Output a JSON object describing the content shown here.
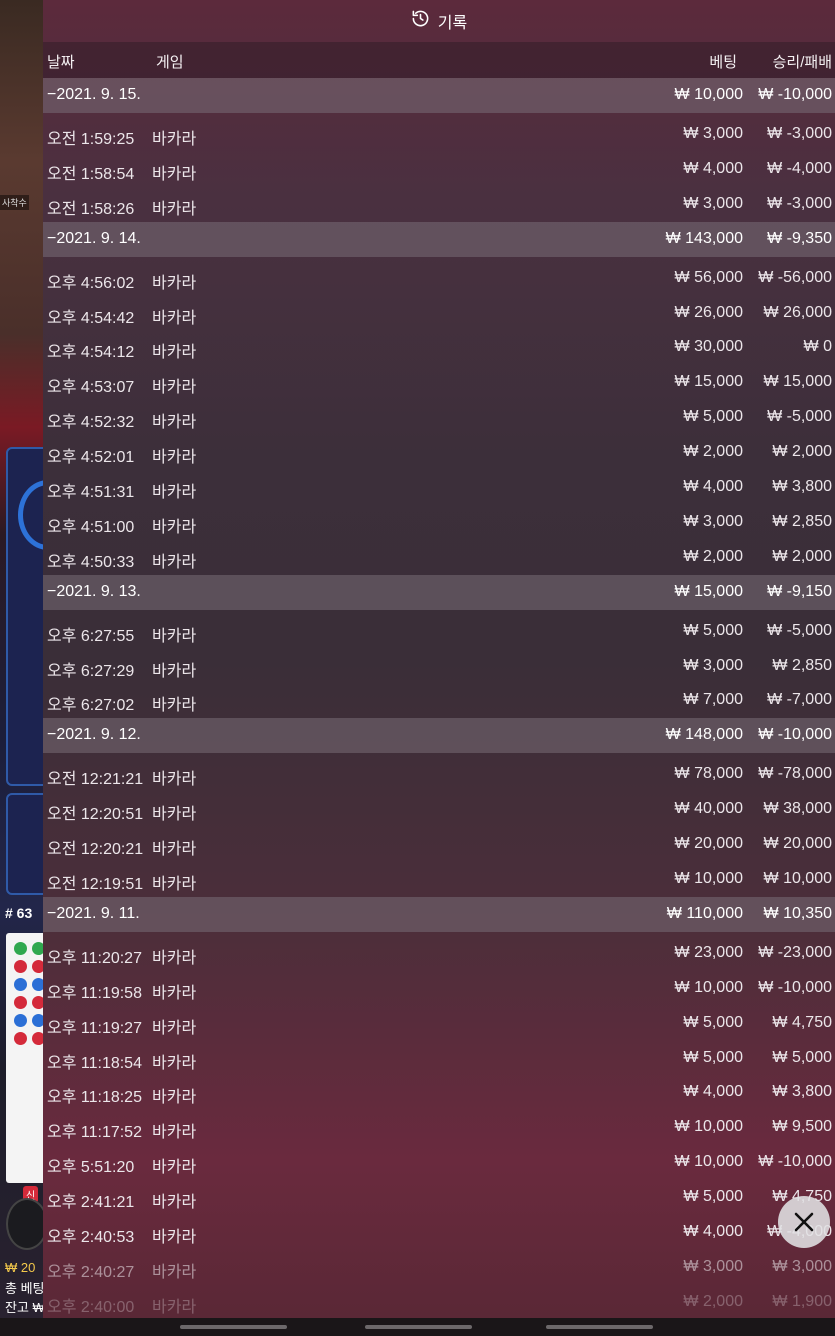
{
  "title": "기록",
  "columns": {
    "date": "날짜",
    "game": "게임",
    "bet": "베팅",
    "result": "승리/패배"
  },
  "background": {
    "frame_label": "사착수",
    "round_label": "# 63",
    "new_badge": "신",
    "balance_partial": "₩ 20",
    "total_bet_partial": "총 베팅",
    "balance_label_partial": "잔고 ₩"
  },
  "groups": [
    {
      "date": "−2021. 9. 15.",
      "bet": "₩ 10,000",
      "result": "₩ -10,000",
      "rows": [
        {
          "time": "오전 1:59:25",
          "game": "바카라",
          "bet": "₩ 3,000",
          "result": "₩ -3,000"
        },
        {
          "time": "오전 1:58:54",
          "game": "바카라",
          "bet": "₩ 4,000",
          "result": "₩ -4,000"
        },
        {
          "time": "오전 1:58:26",
          "game": "바카라",
          "bet": "₩ 3,000",
          "result": "₩ -3,000"
        }
      ]
    },
    {
      "date": "−2021. 9. 14.",
      "bet": "₩ 143,000",
      "result": "₩ -9,350",
      "rows": [
        {
          "time": "오후 4:56:02",
          "game": "바카라",
          "bet": "₩ 56,000",
          "result": "₩ -56,000"
        },
        {
          "time": "오후 4:54:42",
          "game": "바카라",
          "bet": "₩ 26,000",
          "result": "₩ 26,000"
        },
        {
          "time": "오후 4:54:12",
          "game": "바카라",
          "bet": "₩ 30,000",
          "result": "₩ 0"
        },
        {
          "time": "오후 4:53:07",
          "game": "바카라",
          "bet": "₩ 15,000",
          "result": "₩ 15,000"
        },
        {
          "time": "오후 4:52:32",
          "game": "바카라",
          "bet": "₩ 5,000",
          "result": "₩ -5,000"
        },
        {
          "time": "오후 4:52:01",
          "game": "바카라",
          "bet": "₩ 2,000",
          "result": "₩ 2,000"
        },
        {
          "time": "오후 4:51:31",
          "game": "바카라",
          "bet": "₩ 4,000",
          "result": "₩ 3,800"
        },
        {
          "time": "오후 4:51:00",
          "game": "바카라",
          "bet": "₩ 3,000",
          "result": "₩ 2,850"
        },
        {
          "time": "오후 4:50:33",
          "game": "바카라",
          "bet": "₩ 2,000",
          "result": "₩ 2,000"
        }
      ]
    },
    {
      "date": "−2021. 9. 13.",
      "bet": "₩ 15,000",
      "result": "₩ -9,150",
      "rows": [
        {
          "time": "오후 6:27:55",
          "game": "바카라",
          "bet": "₩ 5,000",
          "result": "₩ -5,000"
        },
        {
          "time": "오후 6:27:29",
          "game": "바카라",
          "bet": "₩ 3,000",
          "result": "₩ 2,850"
        },
        {
          "time": "오후 6:27:02",
          "game": "바카라",
          "bet": "₩ 7,000",
          "result": "₩ -7,000"
        }
      ]
    },
    {
      "date": "−2021. 9. 12.",
      "bet": "₩ 148,000",
      "result": "₩ -10,000",
      "rows": [
        {
          "time": "오전 12:21:21",
          "game": "바카라",
          "bet": "₩ 78,000",
          "result": "₩ -78,000"
        },
        {
          "time": "오전 12:20:51",
          "game": "바카라",
          "bet": "₩ 40,000",
          "result": "₩ 38,000"
        },
        {
          "time": "오전 12:20:21",
          "game": "바카라",
          "bet": "₩ 20,000",
          "result": "₩ 20,000"
        },
        {
          "time": "오전 12:19:51",
          "game": "바카라",
          "bet": "₩ 10,000",
          "result": "₩ 10,000"
        }
      ]
    },
    {
      "date": "−2021. 9. 11.",
      "bet": "₩ 110,000",
      "result": "₩ 10,350",
      "rows": [
        {
          "time": "오후 11:20:27",
          "game": "바카라",
          "bet": "₩ 23,000",
          "result": "₩ -23,000"
        },
        {
          "time": "오후 11:19:58",
          "game": "바카라",
          "bet": "₩ 10,000",
          "result": "₩ -10,000"
        },
        {
          "time": "오후 11:19:27",
          "game": "바카라",
          "bet": "₩ 5,000",
          "result": "₩ 4,750"
        },
        {
          "time": "오후 11:18:54",
          "game": "바카라",
          "bet": "₩ 5,000",
          "result": "₩ 5,000"
        },
        {
          "time": "오후 11:18:25",
          "game": "바카라",
          "bet": "₩ 4,000",
          "result": "₩ 3,800"
        },
        {
          "time": "오후 11:17:52",
          "game": "바카라",
          "bet": "₩ 10,000",
          "result": "₩ 9,500"
        },
        {
          "time": "오후 5:51:20",
          "game": "바카라",
          "bet": "₩ 10,000",
          "result": "₩ -10,000"
        },
        {
          "time": "오후 2:41:21",
          "game": "바카라",
          "bet": "₩ 5,000",
          "result": "₩ 4,750"
        },
        {
          "time": "오후 2:40:53",
          "game": "바카라",
          "bet": "₩ 4,000",
          "result": "₩ -4,000"
        },
        {
          "time": "오후 2:40:27",
          "game": "바카라",
          "bet": "₩ 3,000",
          "result": "₩ 3,000"
        },
        {
          "time": "오후 2:40:00",
          "game": "바카라",
          "bet": "₩ 2,000",
          "result": "₩ 1,900"
        }
      ]
    }
  ],
  "colors": {
    "panel": "#3c2f3a",
    "date_row": "#78707a",
    "close_button": "#e1e1e4"
  },
  "icons": {
    "title": "history-icon",
    "close": "close-icon"
  }
}
